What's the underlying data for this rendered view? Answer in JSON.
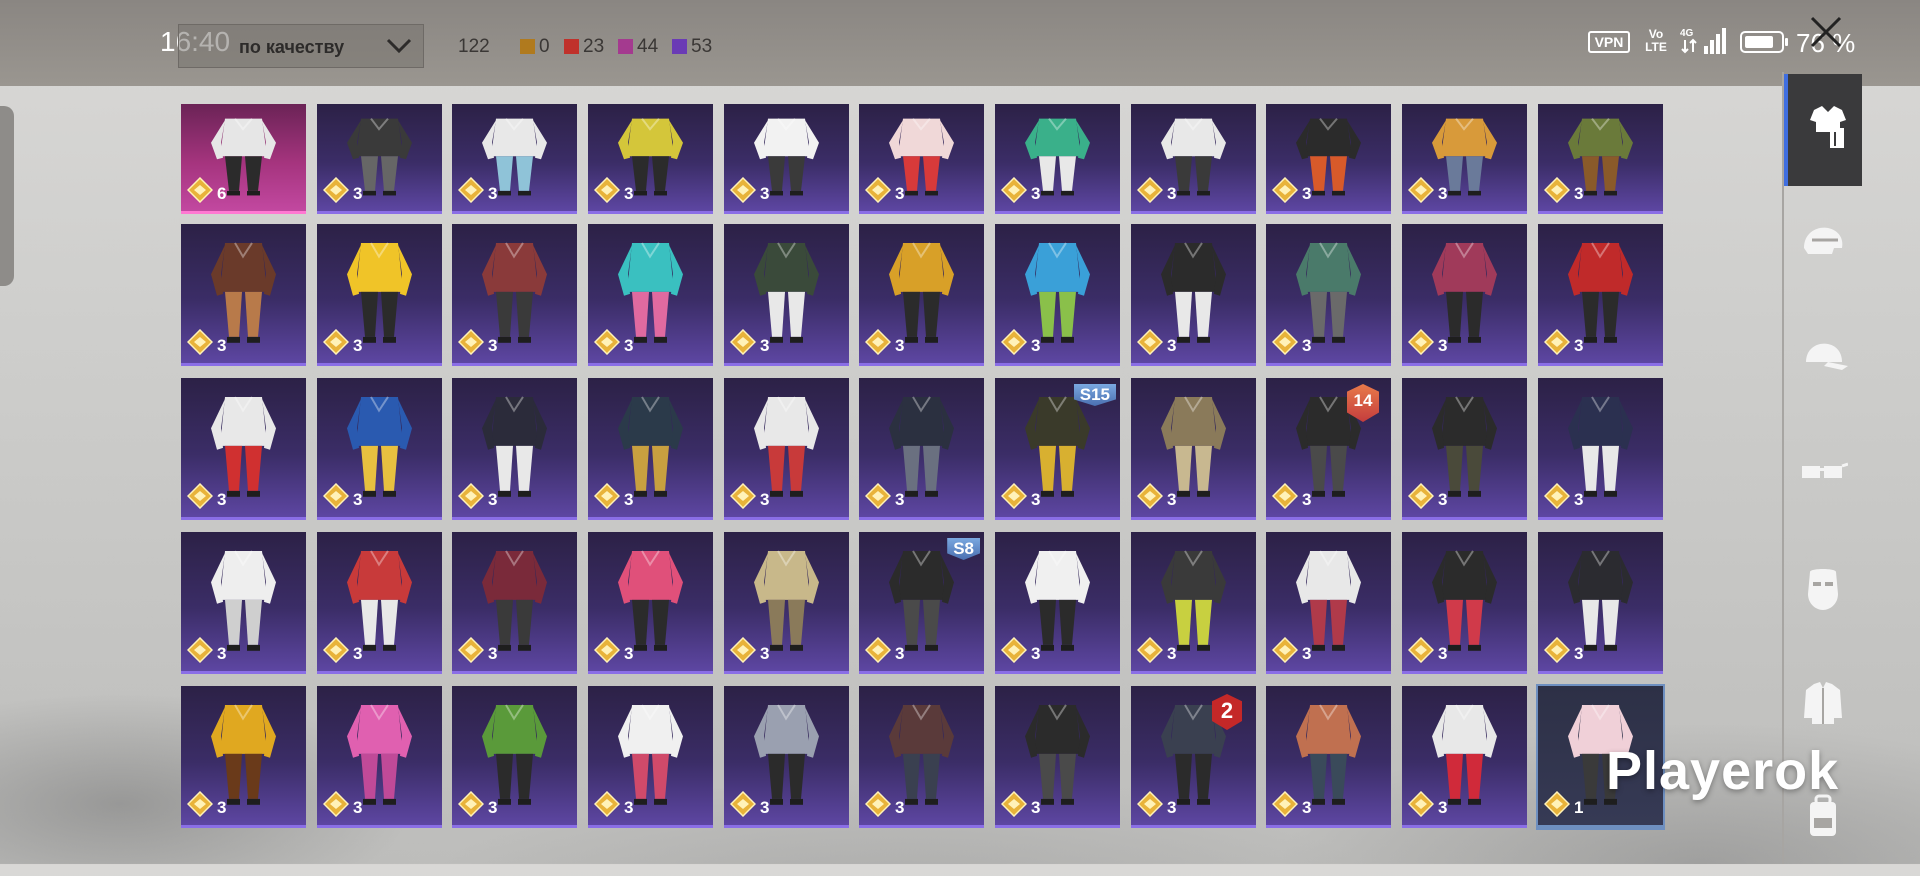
{
  "status_bar": {
    "time": "16:40",
    "vpn": "VPN",
    "volte_top": "Vo",
    "volte_bottom": "LTE",
    "network": "4G",
    "battery": "76 %"
  },
  "toolbar": {
    "sort_dropdown": "по качеству",
    "total_count": "122",
    "quality_counts": [
      {
        "value": "0",
        "color": "#b07a1e"
      },
      {
        "value": "23",
        "color": "#c0312b"
      },
      {
        "value": "44",
        "color": "#a43a8f"
      },
      {
        "value": "53",
        "color": "#6a3bb5"
      }
    ]
  },
  "sidebar": {
    "categories": [
      {
        "icon": "outfit-icon",
        "active": true
      },
      {
        "icon": "helmet-icon",
        "active": false
      },
      {
        "icon": "cap-icon",
        "active": false
      },
      {
        "icon": "glasses-icon",
        "active": false
      },
      {
        "icon": "mask-icon",
        "active": false
      },
      {
        "icon": "jacket-icon",
        "active": false
      },
      {
        "icon": "backpack-icon",
        "active": false
      }
    ]
  },
  "inventory": {
    "rows": [
      [
        {
          "count": "6",
          "style": "pink",
          "palette": [
            "#e6e6e6",
            "#2b2b2b"
          ]
        },
        {
          "count": "3",
          "palette": [
            "#3a3a3a",
            "#666666"
          ]
        },
        {
          "count": "3",
          "palette": [
            "#e8e8e8",
            "#8fc3d8"
          ]
        },
        {
          "count": "3",
          "palette": [
            "#d4c63a",
            "#2b2b2b"
          ]
        },
        {
          "count": "3",
          "palette": [
            "#f2f2f2",
            "#3a3a3a"
          ]
        },
        {
          "count": "3",
          "palette": [
            "#f0d8d8",
            "#d83a3a"
          ]
        },
        {
          "count": "3",
          "palette": [
            "#3ab08a",
            "#e8e8e8"
          ]
        },
        {
          "count": "3",
          "palette": [
            "#e8e8e8",
            "#3a3a3a"
          ]
        },
        {
          "count": "3",
          "palette": [
            "#2b2b2b",
            "#d85a2a"
          ]
        },
        {
          "count": "3",
          "palette": [
            "#d89a3a",
            "#6a7a9a"
          ]
        },
        {
          "count": "3",
          "palette": [
            "#6a7a3a",
            "#8a5a2a"
          ]
        }
      ],
      [
        {
          "count": "3",
          "palette": [
            "#6a3a2a",
            "#b87a4a"
          ]
        },
        {
          "count": "3",
          "palette": [
            "#f0c428",
            "#2b2b2b"
          ]
        },
        {
          "count": "3",
          "palette": [
            "#8a3a3a",
            "#3a3a3a"
          ]
        },
        {
          "count": "3",
          "palette": [
            "#3ac0c0",
            "#e06aa0"
          ]
        },
        {
          "count": "3",
          "palette": [
            "#3a4a3a",
            "#e8e8e8"
          ]
        },
        {
          "count": "3",
          "palette": [
            "#d8a028",
            "#2b2b2b"
          ]
        },
        {
          "count": "3",
          "palette": [
            "#3aa0d8",
            "#8ac04a"
          ]
        },
        {
          "count": "3",
          "palette": [
            "#2b2b2b",
            "#e8e8e8"
          ]
        },
        {
          "count": "3",
          "palette": [
            "#4a7a6a",
            "#6a6a6a"
          ]
        },
        {
          "count": "3",
          "palette": [
            "#a03a5a",
            "#2b2b2b"
          ]
        },
        {
          "count": "3",
          "palette": [
            "#c02a2a",
            "#2b2b2b"
          ]
        }
      ],
      [
        {
          "count": "3",
          "palette": [
            "#e8e8e8",
            "#d03030"
          ]
        },
        {
          "count": "3",
          "palette": [
            "#2a5ab0",
            "#e8c040"
          ]
        },
        {
          "count": "3",
          "palette": [
            "#2b2b3a",
            "#e8e8e8"
          ]
        },
        {
          "count": "3",
          "palette": [
            "#2b3a4a",
            "#c8a040"
          ]
        },
        {
          "count": "3",
          "palette": [
            "#e8e8e8",
            "#c83a3a"
          ]
        },
        {
          "count": "3",
          "palette": [
            "#2b3040",
            "#6a7080"
          ]
        },
        {
          "count": "3",
          "palette": [
            "#3a3a2a",
            "#d8b030"
          ],
          "season": "S15"
        },
        {
          "count": "3",
          "palette": [
            "#8a7a5a",
            "#c8b890"
          ]
        },
        {
          "count": "3",
          "palette": [
            "#2b2b2b",
            "#4a4a4a"
          ],
          "level": "14"
        },
        {
          "count": "3",
          "palette": [
            "#2b2b2b",
            "#4a4a3a"
          ]
        },
        {
          "count": "3",
          "palette": [
            "#2b3050",
            "#e8e8e8"
          ]
        }
      ],
      [
        {
          "count": "3",
          "palette": [
            "#eeeeee",
            "#cfcfcf"
          ]
        },
        {
          "count": "3",
          "palette": [
            "#c83a3a",
            "#e8e8e8"
          ]
        },
        {
          "count": "3",
          "palette": [
            "#7a2a3a",
            "#3a3a3a"
          ]
        },
        {
          "count": "3",
          "palette": [
            "#e0507a",
            "#2b2b2b"
          ]
        },
        {
          "count": "3",
          "palette": [
            "#c8b88a",
            "#8a7a5a"
          ]
        },
        {
          "count": "3",
          "palette": [
            "#2b2b2b",
            "#4a4a4a"
          ],
          "season": "S8"
        },
        {
          "count": "3",
          "palette": [
            "#f0f0f0",
            "#2b2b2b"
          ]
        },
        {
          "count": "3",
          "palette": [
            "#3a3a3a",
            "#c8d040"
          ]
        },
        {
          "count": "3",
          "palette": [
            "#e8e8e8",
            "#b03a4a"
          ]
        },
        {
          "count": "3",
          "palette": [
            "#2b2b2b",
            "#d03a4a"
          ]
        },
        {
          "count": "3",
          "palette": [
            "#2b2b30",
            "#e8e8e8"
          ]
        }
      ],
      [
        {
          "count": "3",
          "palette": [
            "#e0a820",
            "#6a3a1a"
          ]
        },
        {
          "count": "3",
          "palette": [
            "#e060b0",
            "#c04a98"
          ]
        },
        {
          "count": "3",
          "palette": [
            "#5a9a3a",
            "#2b2b2b"
          ]
        },
        {
          "count": "3",
          "palette": [
            "#f0f0f0",
            "#d04a6a"
          ]
        },
        {
          "count": "3",
          "palette": [
            "#9aa0b0",
            "#2b2b2b"
          ]
        },
        {
          "count": "3",
          "palette": [
            "#5a3a3a",
            "#3a4050"
          ]
        },
        {
          "count": "3",
          "palette": [
            "#2b2b2b",
            "#4a4a4a"
          ]
        },
        {
          "count": "3",
          "palette": [
            "#3a4050",
            "#2b2b2b"
          ],
          "rank": "2"
        },
        {
          "count": "3",
          "palette": [
            "#c07050",
            "#3a4a5a"
          ]
        },
        {
          "count": "3",
          "palette": [
            "#e8e8e8",
            "#d02a3a"
          ]
        },
        {
          "count": "1",
          "style": "selected",
          "palette": [
            "#f0d0d8",
            "#3a3a3a"
          ]
        }
      ]
    ]
  },
  "watermark": "Playerok"
}
